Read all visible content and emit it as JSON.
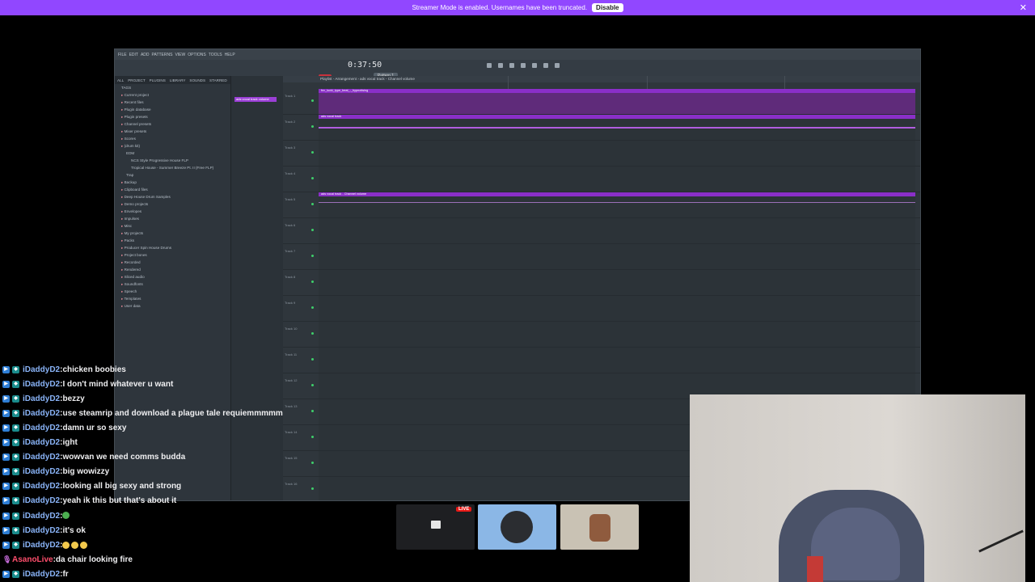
{
  "banner": {
    "text": "Streamer Mode is enabled. Usernames have been truncated.",
    "button": "Disable"
  },
  "daw": {
    "menu": [
      "FILE",
      "EDIT",
      "ADD",
      "PATTERNS",
      "VIEW",
      "OPTIONS",
      "TOOLS",
      "HELP"
    ],
    "clock": "0:37:50",
    "pattern": "Pattern 1",
    "playlist_title": "Playlist - Arrangement › ads vocal track - Channel volume",
    "browser_tabs": [
      "ALL",
      "PROJECT",
      "PLUGINS",
      "LIBRARY",
      "SOUNDS",
      "STARRED"
    ],
    "browser_items": [
      {
        "t": "TAGS",
        "cls": ""
      },
      {
        "t": "Current project",
        "cls": "folder"
      },
      {
        "t": "Recent files",
        "cls": "folder"
      },
      {
        "t": "Plugin database",
        "cls": "folder"
      },
      {
        "t": "Plugin presets",
        "cls": "folder"
      },
      {
        "t": "Channel presets",
        "cls": "folder"
      },
      {
        "t": "Mixer presets",
        "cls": "folder"
      },
      {
        "t": "Scores",
        "cls": "folder"
      },
      {
        "t": "(drum kit)",
        "cls": "folder"
      },
      {
        "t": "EDM",
        "cls": "sub"
      },
      {
        "t": "NCS Style Progressive House FLP",
        "cls": "sub2"
      },
      {
        "t": "Tropical House - Summer Breeze Pt. II (Free FLP)",
        "cls": "sub2"
      },
      {
        "t": "Trap",
        "cls": "sub"
      },
      {
        "t": "Backup",
        "cls": "folder"
      },
      {
        "t": "Clipboard files",
        "cls": "folder"
      },
      {
        "t": "Deep House Drum Samples",
        "cls": "folder"
      },
      {
        "t": "Demo projects",
        "cls": "folder"
      },
      {
        "t": "Envelopes",
        "cls": "folder"
      },
      {
        "t": "Impulses",
        "cls": "folder"
      },
      {
        "t": "Misc",
        "cls": "folder"
      },
      {
        "t": "My projects",
        "cls": "folder"
      },
      {
        "t": "Packs",
        "cls": "folder"
      },
      {
        "t": "Producer Spin House Drums",
        "cls": "folder"
      },
      {
        "t": "Project bones",
        "cls": "folder"
      },
      {
        "t": "Recorded",
        "cls": "folder"
      },
      {
        "t": "Rendered",
        "cls": "folder"
      },
      {
        "t": "Sliced audio",
        "cls": "folder"
      },
      {
        "t": "Soundfonts",
        "cls": "folder"
      },
      {
        "t": "Speech",
        "cls": "folder"
      },
      {
        "t": "Templates",
        "cls": "folder"
      },
      {
        "t": "User data",
        "cls": "folder"
      }
    ],
    "picker_clip": "ads vocal track volume",
    "tracks": [
      {
        "label": "Track 1",
        "clip": "fnv_lucki_type_beat_-_hypnotising",
        "kind": "wave"
      },
      {
        "label": "Track 2",
        "clip": "ads vocal track",
        "kind": "vocal"
      },
      {
        "label": "Track 3",
        "clip": "",
        "kind": "empty"
      },
      {
        "label": "Track 4",
        "clip": "",
        "kind": "empty"
      },
      {
        "label": "Track 5",
        "clip": "ads vocal track - Channel volume",
        "kind": "auto"
      },
      {
        "label": "Track 6",
        "clip": "",
        "kind": "empty"
      },
      {
        "label": "Track 7",
        "clip": "",
        "kind": "empty"
      },
      {
        "label": "Track 8",
        "clip": "",
        "kind": "empty"
      },
      {
        "label": "Track 9",
        "clip": "",
        "kind": "empty"
      },
      {
        "label": "Track 10",
        "clip": "",
        "kind": "empty"
      },
      {
        "label": "Track 11",
        "clip": "",
        "kind": "empty"
      },
      {
        "label": "Track 12",
        "clip": "",
        "kind": "empty"
      },
      {
        "label": "Track 13",
        "clip": "",
        "kind": "empty"
      },
      {
        "label": "Track 14",
        "clip": "",
        "kind": "empty"
      },
      {
        "label": "Track 15",
        "clip": "",
        "kind": "empty"
      },
      {
        "label": "Track 16",
        "clip": "",
        "kind": "empty"
      }
    ]
  },
  "chat": [
    {
      "user": "iDaddyD2",
      "msg": "chicken boobies",
      "style": "normal"
    },
    {
      "user": "iDaddyD2",
      "msg": "I don't mind whatever u want",
      "style": "normal"
    },
    {
      "user": "iDaddyD2",
      "msg": "bezzy",
      "style": "normal"
    },
    {
      "user": "iDaddyD2",
      "msg": "use steamrip and download a plague tale requiemmmmm",
      "style": "normal"
    },
    {
      "user": "iDaddyD2",
      "msg": "damn ur so sexy",
      "style": "normal"
    },
    {
      "user": "iDaddyD2",
      "msg": "ight",
      "style": "normal"
    },
    {
      "user": "iDaddyD2",
      "msg": "wowvan we need comms budda",
      "style": "normal"
    },
    {
      "user": "iDaddyD2",
      "msg": "big wowizzy",
      "style": "normal"
    },
    {
      "user": "iDaddyD2",
      "msg": "looking all big sexy and strong",
      "style": "normal"
    },
    {
      "user": "iDaddyD2",
      "msg": "yeah ik this but that's about it",
      "style": "normal"
    },
    {
      "user": "iDaddyD2",
      "msg": "",
      "style": "emoji-green"
    },
    {
      "user": "iDaddyD2",
      "msg": "it's ok",
      "style": "normal"
    },
    {
      "user": "iDaddyD2",
      "msg": "",
      "style": "emoji-3"
    },
    {
      "user": "AsanoLive",
      "msg": "da chair looking fire",
      "style": "other"
    },
    {
      "user": "iDaddyD2",
      "msg": "fr",
      "style": "normal"
    }
  ],
  "thumbs": {
    "live": "LIVE"
  }
}
